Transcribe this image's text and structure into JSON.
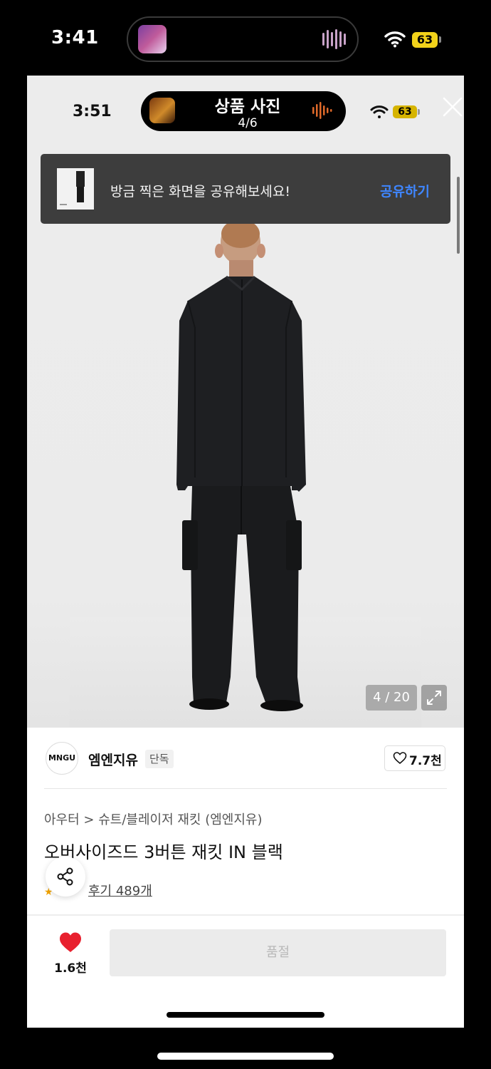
{
  "outer_status": {
    "time": "3:41",
    "battery": "63"
  },
  "inner_status": {
    "time": "3:51",
    "battery": "63"
  },
  "viewer": {
    "title": "상품 사진",
    "position": "4/6"
  },
  "toast": {
    "message": "방금 찍은 화면을 공유해보세요!",
    "action": "공유하기"
  },
  "gallery": {
    "counter": "4 / 20"
  },
  "brand": {
    "logo_text": "MNGU",
    "name": "엠엔지유",
    "badge": "단독",
    "likes": "7.7천"
  },
  "product": {
    "breadcrumb": "아우터 > 슈트/블레이저 재킷 (엠엔지유)",
    "name": "오버사이즈드 3버튼 재킷 IN 블랙",
    "reviews": "후기 489개"
  },
  "bottom_bar": {
    "like_count": "1.6천",
    "buy_label": "품절"
  },
  "colors": {
    "accent_blue": "#3f86ff",
    "heart_red": "#e8202e",
    "battery_yellow": "#f2d21a"
  },
  "icons": [
    "wifi-icon",
    "battery-icon",
    "audio-wave-icon",
    "close-icon",
    "expand-icon",
    "heart-outline-icon",
    "share-icon",
    "heart-filled-icon"
  ]
}
